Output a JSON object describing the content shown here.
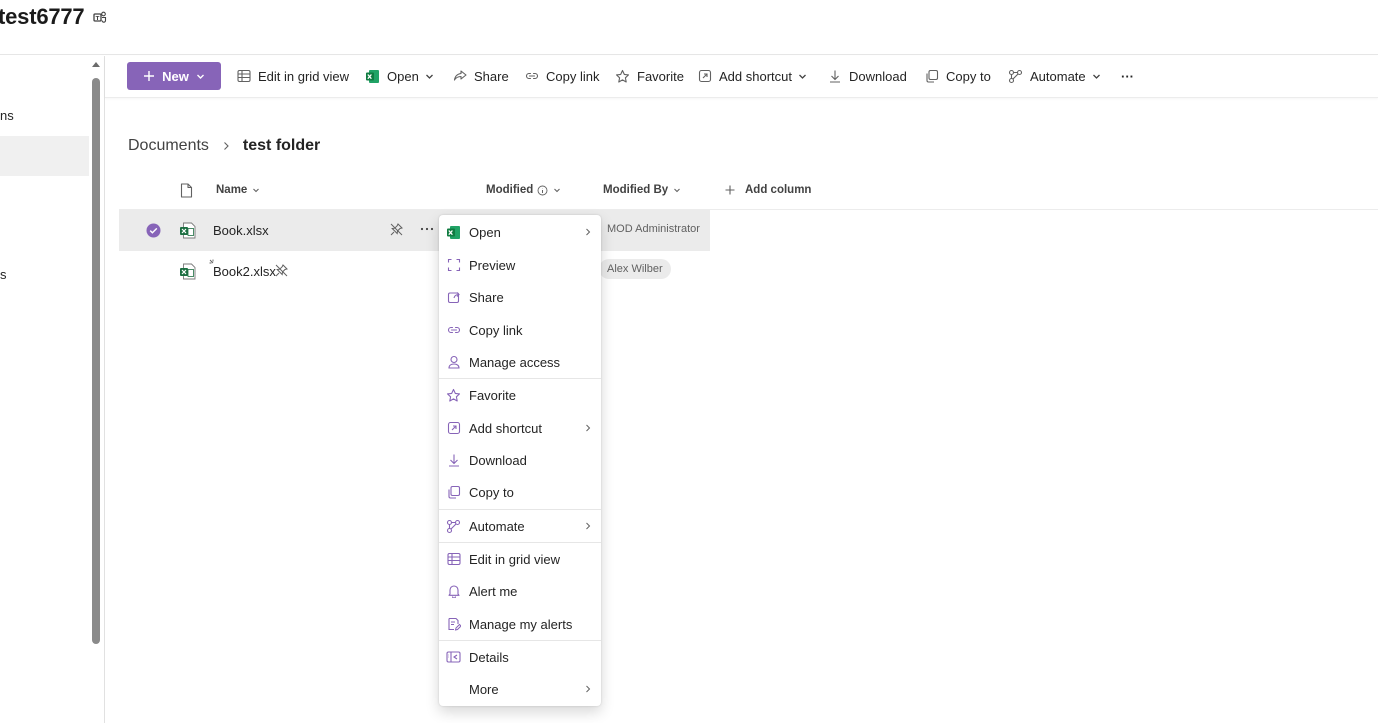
{
  "site": {
    "title": "test6777",
    "teams_icon": "teams-icon"
  },
  "left_nav": {
    "items": [
      {
        "label": "ns",
        "selected": false
      },
      {
        "label": "",
        "selected": true
      },
      {
        "label": "s",
        "selected": false
      }
    ]
  },
  "commandbar": {
    "new_label": "New",
    "edit_grid_label": "Edit in grid view",
    "open_label": "Open",
    "share_label": "Share",
    "copy_link_label": "Copy link",
    "favorite_label": "Favorite",
    "add_shortcut_label": "Add shortcut",
    "download_label": "Download",
    "copy_to_label": "Copy to",
    "automate_label": "Automate",
    "more_label": "···"
  },
  "breadcrumb": {
    "root": "Documents",
    "current": "test folder"
  },
  "columns": {
    "name": "Name",
    "modified": "Modified",
    "modified_by": "Modified By",
    "add_column": "Add column"
  },
  "files": [
    {
      "name": "Book.xlsx",
      "modified_by": "MOD Administrator",
      "selected": true
    },
    {
      "name": "Book2.xlsx",
      "modified_by": "Alex Wilber",
      "selected": false
    }
  ],
  "context_menu": {
    "items": [
      {
        "label": "Open",
        "icon": "excel-icon",
        "submenu": true
      },
      {
        "label": "Preview",
        "icon": "preview-icon",
        "submenu": false
      },
      {
        "label": "Share",
        "icon": "share-icon",
        "submenu": false
      },
      {
        "label": "Copy link",
        "icon": "link-icon",
        "submenu": false
      },
      {
        "label": "Manage access",
        "icon": "person-icon",
        "submenu": false
      },
      {
        "label": "Favorite",
        "icon": "star-icon",
        "submenu": false
      },
      {
        "label": "Add shortcut",
        "icon": "shortcut-icon",
        "submenu": true
      },
      {
        "label": "Download",
        "icon": "download-icon",
        "submenu": false
      },
      {
        "label": "Copy to",
        "icon": "copy-icon",
        "submenu": false
      },
      {
        "label": "Automate",
        "icon": "automate-icon",
        "submenu": true
      },
      {
        "label": "Edit in grid view",
        "icon": "grid-icon",
        "submenu": false
      },
      {
        "label": "Alert me",
        "icon": "bell-icon",
        "submenu": false
      },
      {
        "label": "Manage my alerts",
        "icon": "alerts-icon",
        "submenu": false
      },
      {
        "label": "Details",
        "icon": "details-icon",
        "submenu": false
      },
      {
        "label": "More",
        "icon": "",
        "submenu": true
      }
    ]
  },
  "colors": {
    "accent": "#8764b8",
    "excel": "#1d6f42",
    "selected_row": "#ebebeb"
  }
}
